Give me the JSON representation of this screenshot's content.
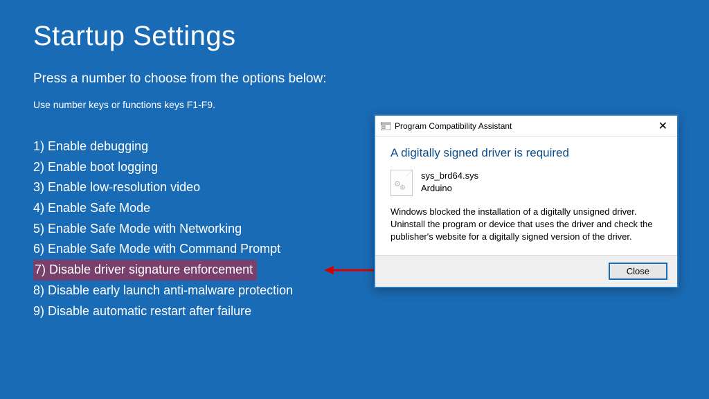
{
  "title": "Startup Settings",
  "subtitle": "Press a number to choose from the options below:",
  "hint": "Use number keys or functions keys F1-F9.",
  "options": [
    "1) Enable debugging",
    "2) Enable boot logging",
    "3) Enable low-resolution video",
    "4) Enable Safe Mode",
    "5) Enable Safe Mode with Networking",
    "6) Enable Safe Mode with Command Prompt",
    "7) Disable driver signature enforcement",
    "8) Disable early launch anti-malware protection",
    "9) Disable automatic restart after failure"
  ],
  "dialog": {
    "window_title": "Program Compatibility Assistant",
    "heading": "A digitally signed driver is required",
    "file_name": "sys_brd64.sys",
    "file_vendor": "Arduino",
    "message": "Windows blocked the installation of a digitally unsigned driver. Uninstall the program or device that uses the driver and check the publisher's website for a digitally signed version of the driver.",
    "close_label": "Close"
  }
}
